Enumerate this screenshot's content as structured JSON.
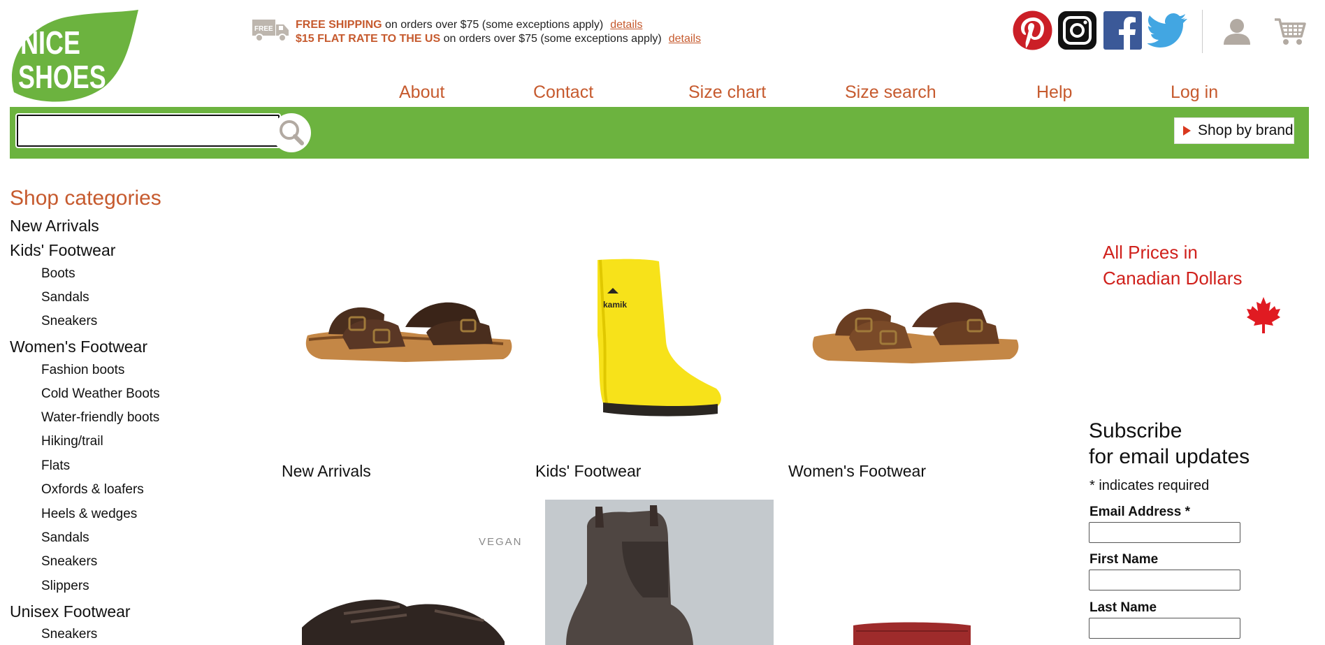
{
  "brand": {
    "logo_text_line1": "NICE",
    "logo_text_line2": "SHOES",
    "green": "#6cb33f",
    "accent": "#c65a2e"
  },
  "shipping": {
    "icon_text": "FREE",
    "line1": {
      "highlight": "FREE SHIPPING",
      "text": " on orders over $75 (some exceptions apply)",
      "link": "details"
    },
    "line2": {
      "highlight": "$15 FLAT RATE TO THE US",
      "text": " on orders over $75 (some exceptions apply)",
      "link": "details"
    }
  },
  "social": [
    "pinterest-icon",
    "instagram-icon",
    "facebook-icon",
    "twitter-icon"
  ],
  "utility": [
    "account-icon",
    "cart-icon"
  ],
  "nav": [
    "About",
    "Contact",
    "Size chart",
    "Size search",
    "Help",
    "Log in"
  ],
  "search": {
    "value": "",
    "placeholder": ""
  },
  "shop_by_brand": "Shop by brand",
  "sidebar": {
    "heading": "Shop categories",
    "items": [
      {
        "label": "New Arrivals",
        "level": 0
      },
      {
        "label": "Kids' Footwear",
        "level": 0
      },
      {
        "label": "Boots",
        "level": 1
      },
      {
        "label": "Sandals",
        "level": 1
      },
      {
        "label": "Sneakers",
        "level": 1
      },
      {
        "label": "Women's Footwear",
        "level": 0
      },
      {
        "label": "Fashion boots",
        "level": 1
      },
      {
        "label": "Cold Weather Boots",
        "level": 1
      },
      {
        "label": "Water-friendly boots",
        "level": 1
      },
      {
        "label": "Hiking/trail",
        "level": 1
      },
      {
        "label": "Flats",
        "level": 1
      },
      {
        "label": "Oxfords & loafers",
        "level": 1
      },
      {
        "label": "Heels & wedges",
        "level": 1
      },
      {
        "label": "Sandals",
        "level": 1
      },
      {
        "label": "Sneakers",
        "level": 1
      },
      {
        "label": "Slippers",
        "level": 1
      },
      {
        "label": "Unisex Footwear",
        "level": 0
      },
      {
        "label": "Sneakers",
        "level": 1
      }
    ]
  },
  "tiles": [
    {
      "label": "New Arrivals",
      "image": "brown-sandal"
    },
    {
      "label": "Kids' Footwear",
      "image": "yellow-rain-boot",
      "boot_text": "kamik"
    },
    {
      "label": "Women's Footwear",
      "image": "brown-sandal"
    }
  ],
  "tiles_row2": [
    {
      "image": "dark-sneaker",
      "badge": "VEGAN"
    },
    {
      "image": "chelsea-boot"
    },
    {
      "image": "red-bag"
    }
  ],
  "price_note": {
    "line1": "All Prices in",
    "line2": "Canadian Dollars"
  },
  "subscribe": {
    "heading_line1": "Subscribe",
    "heading_line2": "for email updates",
    "required_note": "* indicates required",
    "fields": [
      {
        "label": "Email Address *",
        "value": ""
      },
      {
        "label": "First Name",
        "value": ""
      },
      {
        "label": "Last Name",
        "value": ""
      }
    ]
  }
}
